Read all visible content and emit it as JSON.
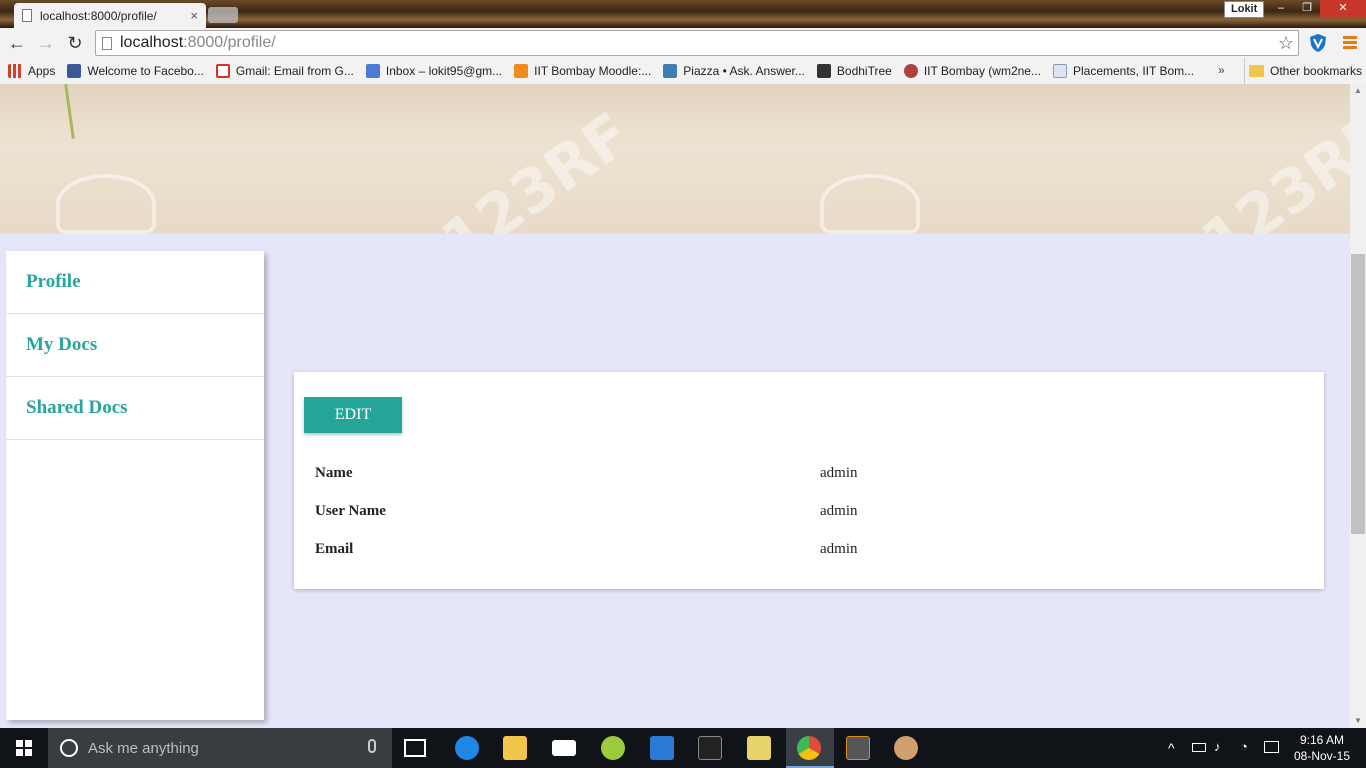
{
  "browser": {
    "tab_title": "localhost:8000/profile/",
    "tab_close": "×",
    "profile_name": "Lokit",
    "url_host": "localhost",
    "url_path": ":8000/profile/",
    "back": "←",
    "forward": "→",
    "reload": "↻",
    "star": "☆",
    "minimize": "–",
    "restore": "❐",
    "close": "✕"
  },
  "bookmarks": {
    "items": [
      {
        "label": "Apps",
        "color": "#d0402a"
      },
      {
        "label": "Welcome to Facebo...",
        "color": "#3b5998"
      },
      {
        "label": "Gmail: Email from G...",
        "color": "#d93025"
      },
      {
        "label": "Inbox – lokit95@gm...",
        "color": "#4a7bd6"
      },
      {
        "label": "IIT Bombay Moodle:...",
        "color": "#f28a1e"
      },
      {
        "label": "Piazza • Ask. Answer...",
        "color": "#3e7cb1"
      },
      {
        "label": "BodhiTree",
        "color": "#333333"
      },
      {
        "label": "IIT Bombay (wm2ne...",
        "color": "#b04040"
      },
      {
        "label": "Placements, IIT Bom...",
        "color": "#8899bb"
      }
    ],
    "overflow": "»",
    "other": "Other bookmarks"
  },
  "banner": {
    "watermark": "123RF"
  },
  "sidebar": {
    "items": [
      {
        "label": "Profile"
      },
      {
        "label": "My Docs"
      },
      {
        "label": "Shared Docs"
      }
    ]
  },
  "profile": {
    "edit_label": "EDIT",
    "fields": [
      {
        "label": "Name",
        "value": "admin"
      },
      {
        "label": "User Name",
        "value": "admin"
      },
      {
        "label": "Email",
        "value": "admin"
      }
    ]
  },
  "taskbar": {
    "search_placeholder": "Ask me anything",
    "time": "9:16 AM",
    "date": "08-Nov-15",
    "apps": [
      {
        "name": "task-view-icon",
        "color": "#ffffff"
      },
      {
        "name": "edge-icon",
        "color": "#1e88e5"
      },
      {
        "name": "file-explorer-icon",
        "color": "#f2c54b"
      },
      {
        "name": "mail-icon",
        "color": "#ffffff"
      },
      {
        "name": "app-icon-green",
        "color": "#9ccc3c"
      },
      {
        "name": "powershell-icon",
        "color": "#2b7bd6"
      },
      {
        "name": "terminal-icon",
        "color": "#222222"
      },
      {
        "name": "app-icon-yellow",
        "color": "#e8d36a"
      },
      {
        "name": "chrome-icon",
        "color": "#e04b3a"
      },
      {
        "name": "sublime-icon",
        "color": "#555555"
      },
      {
        "name": "paint-icon",
        "color": "#d0a070"
      }
    ]
  },
  "colors": {
    "accent": "#26a69a",
    "page_bg": "#e6e6fa"
  }
}
